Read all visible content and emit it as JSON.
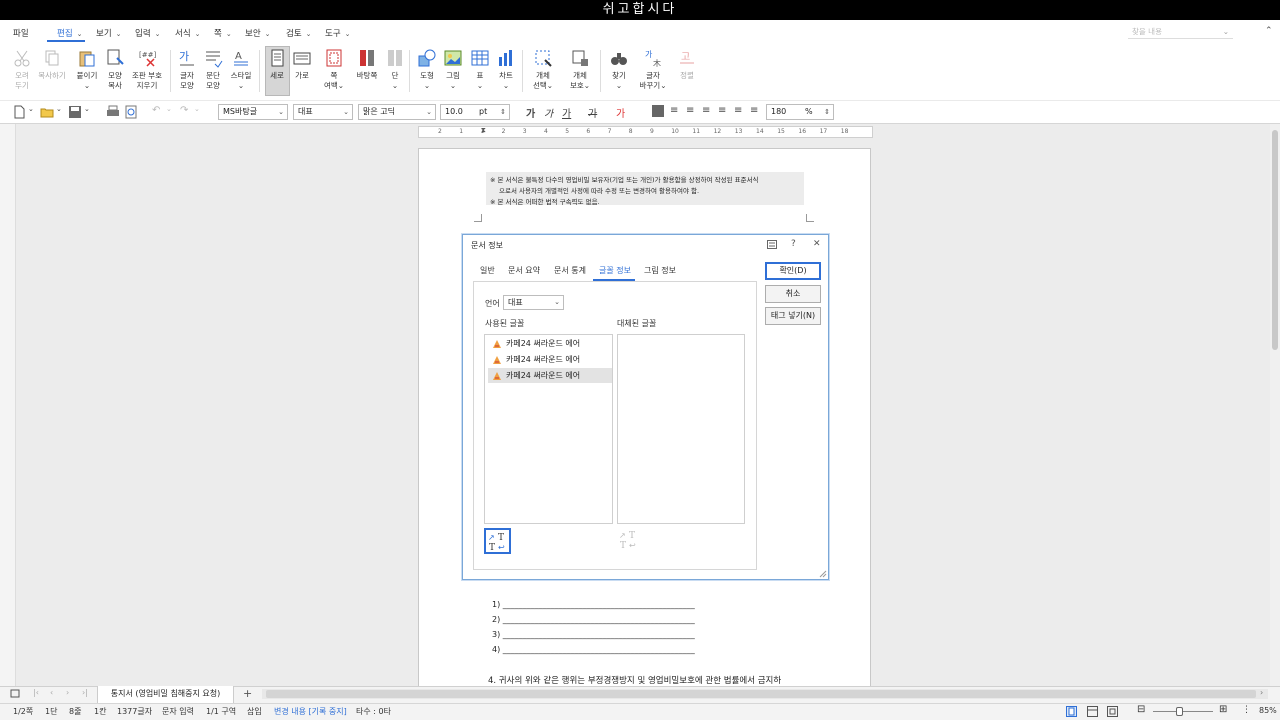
{
  "window": {
    "title": "쉬고합시다"
  },
  "menu": {
    "items": [
      {
        "label": "파일",
        "chev": false
      },
      {
        "label": "편집",
        "chev": true,
        "active": true
      },
      {
        "label": "보기",
        "chev": true
      },
      {
        "label": "입력",
        "chev": true
      },
      {
        "label": "서식",
        "chev": true
      },
      {
        "label": "쪽",
        "chev": true
      },
      {
        "label": "보안",
        "chev": true
      },
      {
        "label": "검토",
        "chev": true
      },
      {
        "label": "도구",
        "chev": true
      }
    ],
    "help_search_placeholder": "찾을 내용"
  },
  "ribbon": {
    "buttons": [
      {
        "label": "오려\n두기",
        "icon": "scissors-icon",
        "disabled": true
      },
      {
        "label": "복사하기",
        "icon": "copy-icon",
        "disabled": true
      },
      {
        "label": "붙이기\n⌄",
        "icon": "paste-icon"
      },
      {
        "label": "모양\n복사",
        "icon": "format-painter-icon"
      },
      {
        "label": "조판 부호\n지우기",
        "icon": "clear-codes-icon"
      },
      {
        "label": "글자\n모양",
        "icon": "char-shape-icon"
      },
      {
        "label": "문단\n모양",
        "icon": "para-shape-icon"
      },
      {
        "label": "스타일\n⌄",
        "icon": "style-icon"
      },
      {
        "label": "세로",
        "icon": "portrait-icon",
        "selected": true
      },
      {
        "label": "가로",
        "icon": "landscape-icon"
      },
      {
        "label": "쪽\n여백⌄",
        "icon": "page-margin-icon"
      },
      {
        "label": "바탕쪽\n",
        "icon": "master-page-icon"
      },
      {
        "label": "단\n⌄",
        "icon": "columns-icon"
      },
      {
        "label": "도형\n⌄",
        "icon": "shape-icon"
      },
      {
        "label": "그림\n⌄",
        "icon": "picture-icon"
      },
      {
        "label": "표\n⌄",
        "icon": "table-icon"
      },
      {
        "label": "차트\n⌄",
        "icon": "chart-icon"
      },
      {
        "label": "개체\n선택⌄",
        "icon": "object-select-icon"
      },
      {
        "label": "개체\n보호⌄",
        "icon": "object-protect-icon"
      },
      {
        "label": "찾기\n⌄",
        "icon": "binoculars-icon"
      },
      {
        "label": "글자\n바꾸기⌄",
        "icon": "char-convert-icon"
      },
      {
        "label": "정렬",
        "icon": "sort-icon",
        "disabled": true
      }
    ]
  },
  "toolbar": {
    "style_combo": "MS바탕글",
    "lang_combo": "대표",
    "font_combo": "맑은 고딕",
    "size_value": "10.0",
    "size_unit": "pt",
    "line_spacing_value": "180",
    "line_spacing_unit": "%"
  },
  "ruler": {
    "numbers": [
      "2",
      "1",
      "1",
      "2",
      "3",
      "4",
      "5",
      "6",
      "7",
      "8",
      "9",
      "10",
      "11",
      "12",
      "13",
      "14",
      "15",
      "16",
      "17",
      "18"
    ]
  },
  "document": {
    "notes": [
      "※ 본 서식은 불특정 다수의 영업비밀 보유자(기업 또는 개인)가 활용함을 상정하여 작성된 표준서식",
      "으로서 사용자의 개별적인 사정에 따라 수정 또는 변경하여 활용하여야 함.",
      "※ 본 서식은 어떠한 법적 구속력도 없음."
    ],
    "list_lines": [
      "1)  ________________________________________________",
      "2)  ________________________________________________",
      "3)  ________________________________________________",
      "4)  ________________________________________________"
    ],
    "paragraph": "4. 귀사의 위와 같은 행위는 부정경쟁방지 및 영업비밀보호에 관한 법률에서 금지하"
  },
  "dialog": {
    "title": "문서 정보",
    "tabs": [
      "일반",
      "문서 요약",
      "문서 통계",
      "글꼴 정보",
      "그림 정보"
    ],
    "active_tab": 3,
    "language_label": "언어",
    "language_value": "대표",
    "used_fonts_label": "사용된 글꼴",
    "substituted_fonts_label": "대체된 글꼴",
    "used_fonts": [
      "카페24 써라운드 에어",
      "카페24 써라운드 에어",
      "카페24 써라운드 에어"
    ],
    "selected_font_index": 2,
    "ok_label": "확인(D)",
    "cancel_label": "취소",
    "insert_tag_label": "태그 넣기(N)"
  },
  "bottom_tab": {
    "doc_tab": "통지서 (영업비밀 침해중지 요청)"
  },
  "statusbar": {
    "items": [
      {
        "text": "1/2쪽"
      },
      {
        "text": "1단"
      },
      {
        "text": "8줄"
      },
      {
        "text": "1칸"
      },
      {
        "text": "1377글자"
      },
      {
        "text": "문자 입력"
      },
      {
        "text": "1/1 구역"
      },
      {
        "text": "삽입"
      },
      {
        "text": "변경 내용 [기록 중지]",
        "blue": true
      },
      {
        "text": "타수 : 0타"
      }
    ],
    "zoom": "85%"
  },
  "colors": {
    "accent": "#2f6fd6",
    "dialog_border": "#7aa7d8",
    "titlebar": "#000000"
  }
}
